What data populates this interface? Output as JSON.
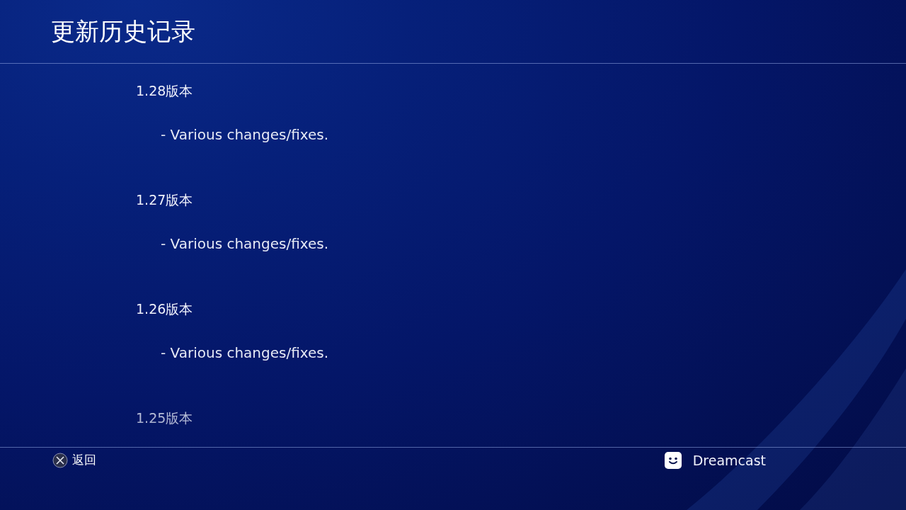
{
  "header": {
    "title": "更新历史记录"
  },
  "versions": [
    {
      "version": "1.28版本",
      "notes": [
        "- Various changes/fixes."
      ]
    },
    {
      "version": "1.27版本",
      "notes": [
        "- Various changes/fixes."
      ]
    },
    {
      "version": "1.26版本",
      "notes": [
        "- Various changes/fixes."
      ]
    },
    {
      "version": "1.25版本"
    }
  ],
  "footer": {
    "back_label": "返回",
    "app_name": "Dreamcast"
  }
}
